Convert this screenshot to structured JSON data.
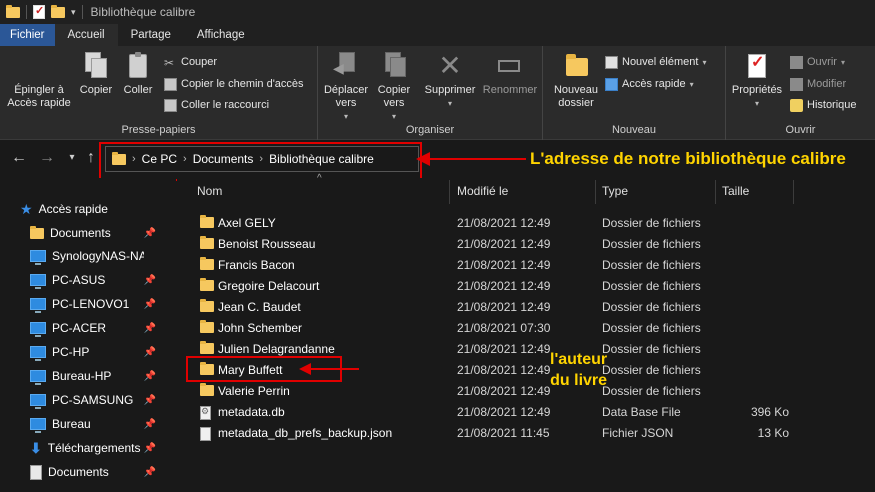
{
  "window": {
    "title": "Bibliothèque calibre"
  },
  "tabs": [
    {
      "label": "Fichier"
    },
    {
      "label": "Accueil"
    },
    {
      "label": "Partage"
    },
    {
      "label": "Affichage"
    }
  ],
  "ribbon": {
    "presse_papiers": {
      "label": "Presse-papiers",
      "pin_l1": "Épingler à",
      "pin_l2": "Accès rapide",
      "copy": "Copier",
      "paste": "Coller",
      "cut": "Couper",
      "copy_path": "Copier le chemin d'accès",
      "paste_shortcut": "Coller le raccourci"
    },
    "organiser": {
      "label": "Organiser",
      "move_l1": "Déplacer",
      "move_l2": "vers",
      "copyto_l1": "Copier",
      "copyto_l2": "vers",
      "delete": "Supprimer",
      "rename": "Renommer"
    },
    "nouveau": {
      "label": "Nouveau",
      "newfolder_l1": "Nouveau",
      "newfolder_l2": "dossier",
      "new_item": "Nouvel élément",
      "easy_access": "Accès rapide"
    },
    "ouvrir": {
      "label": "Ouvrir",
      "properties": "Propriétés",
      "open": "Ouvrir",
      "edit": "Modifier",
      "history": "Historique"
    }
  },
  "address": {
    "crumbs": [
      "Ce PC",
      "Documents",
      "Bibliothèque calibre"
    ]
  },
  "annotations": {
    "address_note": "L'adresse de notre bibliothèque calibre",
    "author_l1": "l'auteur",
    "author_l2": "du livre"
  },
  "sidebar": {
    "items": [
      {
        "label": "Accès rapide",
        "icon": "star-icon"
      },
      {
        "label": "Documents",
        "icon": "folder-icon"
      },
      {
        "label": "SynologyNAS-NAS",
        "icon": "monitor-icon"
      },
      {
        "label": "PC-ASUS",
        "icon": "monitor-icon"
      },
      {
        "label": "PC-LENOVO1",
        "icon": "monitor-icon"
      },
      {
        "label": "PC-ACER",
        "icon": "monitor-icon"
      },
      {
        "label": "PC-HP",
        "icon": "monitor-icon"
      },
      {
        "label": "Bureau-HP",
        "icon": "monitor-icon"
      },
      {
        "label": "PC-SAMSUNG",
        "icon": "monitor-icon"
      },
      {
        "label": "Bureau",
        "icon": "monitor-icon"
      },
      {
        "label": "Téléchargements",
        "icon": "download-icon"
      },
      {
        "label": "Documents",
        "icon": "document-icon"
      }
    ]
  },
  "filelist": {
    "columns": {
      "name": "Nom",
      "modified": "Modifié le",
      "type": "Type",
      "size": "Taille"
    },
    "rows": [
      {
        "name": "Axel GELY",
        "modified": "21/08/2021 12:49",
        "type": "Dossier de fichiers",
        "size": ""
      },
      {
        "name": "Benoist Rousseau",
        "modified": "21/08/2021 12:49",
        "type": "Dossier de fichiers",
        "size": ""
      },
      {
        "name": "Francis Bacon",
        "modified": "21/08/2021 12:49",
        "type": "Dossier de fichiers",
        "size": ""
      },
      {
        "name": "Gregoire Delacourt",
        "modified": "21/08/2021 12:49",
        "type": "Dossier de fichiers",
        "size": ""
      },
      {
        "name": "Jean C. Baudet",
        "modified": "21/08/2021 12:49",
        "type": "Dossier de fichiers",
        "size": ""
      },
      {
        "name": "John Schember",
        "modified": "21/08/2021 07:30",
        "type": "Dossier de fichiers",
        "size": ""
      },
      {
        "name": "Julien Delagrandanne",
        "modified": "21/08/2021 12:49",
        "type": "Dossier de fichiers",
        "size": ""
      },
      {
        "name": "Mary Buffett",
        "modified": "21/08/2021 12:49",
        "type": "Dossier de fichiers",
        "size": ""
      },
      {
        "name": "Valerie Perrin",
        "modified": "21/08/2021 12:49",
        "type": "Dossier de fichiers",
        "size": ""
      },
      {
        "name": "metadata.db",
        "modified": "21/08/2021 12:49",
        "type": "Data Base File",
        "size": "396 Ko"
      },
      {
        "name": "metadata_db_prefs_backup.json",
        "modified": "21/08/2021 11:45",
        "type": "Fichier JSON",
        "size": "13 Ko"
      }
    ]
  },
  "colors": {
    "background": "#191919",
    "ribbon": "#2b2b2b",
    "file_tab": "#2b5797",
    "folder": "#f6c85f",
    "highlight": "#e00000",
    "annotation": "#ffd400"
  }
}
